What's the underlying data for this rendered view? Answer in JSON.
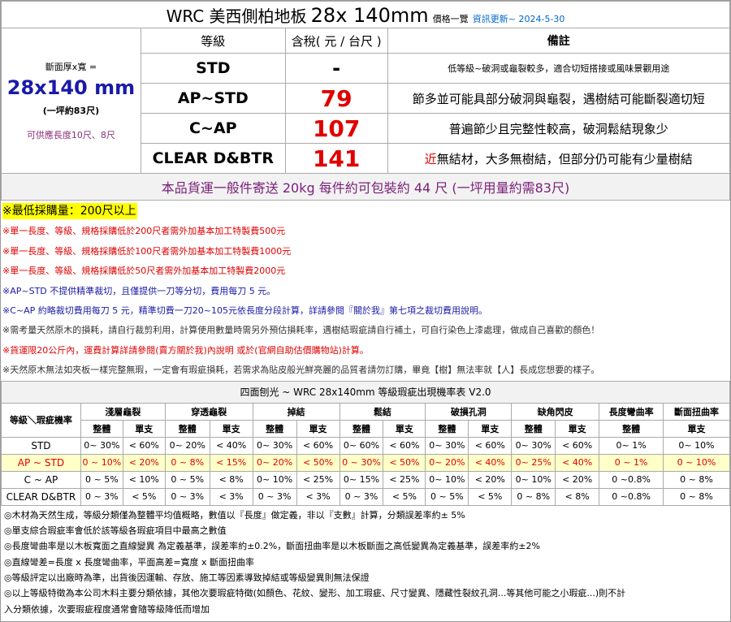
{
  "title": {
    "main": "WRC 美西側柏地板",
    "size": "28x 140mm",
    "subtitle": "價格一覽",
    "update": "資訊更新~ 2024-5-30"
  },
  "price_table": {
    "headers": {
      "grade": "等級",
      "price": "含稅( 元 / 台尺 )",
      "note": "備註"
    },
    "left": {
      "label": "斷面厚x寬 =",
      "size": "28x140 mm",
      "per_ping": "(一坪約83尺)",
      "length": "可供應長度10尺、8尺"
    },
    "rows": [
      {
        "grade": "STD",
        "price": "-",
        "note": "低等級~破洞或龜裂較多，適合切短搭接或風味景觀用途"
      },
      {
        "grade": "AP~STD",
        "price": "79",
        "note": "節多並可能具部分破洞與龜裂，遇樹結可能斷裂適切短"
      },
      {
        "grade": "C~AP",
        "price": "107",
        "note": "普遍節少且完整性較高，破洞鬆結現象少"
      },
      {
        "grade": "CLEAR  D&BTR",
        "price": "141",
        "note_red": "近",
        "note": "無結材，大多無樹結，但部分仍可能有少量樹結"
      }
    ],
    "shipping": "本品貨運一般件寄送 20kg 每件約可包裝約 44 尺 (一坪用量約需83尺)"
  },
  "notes": {
    "min_order": "※最低採購量：200尺以上",
    "lines": [
      "※單一長度、等級、規格採購低於200尺者需外加基本加工特製費500元",
      "※單一長度、等級、規格採購低於100尺者需外加基本加工特製費1000元",
      "※單一長度、等級、規格採購低於50尺者需外加基本加工特製費2000元",
      "※AP~STD 不提供精準裁切，且僅提供一刀等分切，費用每刀 5 元。",
      "※C~AP 約略裁切費用每刀 5 元，精準切費一刀20~105元依長度分段計算，詳請參閱『關於我』第七項之裁切費用說明。",
      "※需考量天然原木的損耗，請自行裁剪利用，計算使用數量時需另外預估損耗率，遇樹結瑕疵請自行補土，可自行染色上漆處理，做成自己喜歡的顏色！",
      "※貨運限20公斤內，運費計算詳請參閱(賣方關於我)內說明 或於(官網自助估價購物站)計算。",
      "※天然原木無法如夾板一樣完整無瑕，一定會有瑕疵損耗，若需求為貼皮般光鮮亮麗的品質者請勿訂購，畢竟【樹】無法率就【人】長成您想要的樣子。"
    ]
  },
  "defect_table": {
    "title": "四面刨光 ~ WRC 28x140mm 等級瑕疵出現機率表 V2.0",
    "corner": "等級＼瑕疵機率",
    "groups": [
      "淺層龜裂",
      "穿透龜裂",
      "掉結",
      "鬆結",
      "破損孔洞",
      "缺角閃皮",
      "長度彎曲率",
      "斷面扭曲率"
    ],
    "sub": {
      "whole": "整體",
      "single": "單支"
    },
    "rows": [
      {
        "grade": "STD",
        "cells": [
          "0~ 30%",
          "< 60%",
          "0~ 20%",
          "< 40%",
          "0~ 30%",
          "< 60%",
          "0~ 60%",
          "< 60%",
          "0~ 30%",
          "< 60%",
          "0~ 30%",
          "< 60%",
          "0~ 1%",
          "0~ 10%"
        ]
      },
      {
        "grade": "AP ~ STD",
        "cells": [
          "0 ~ 10%",
          "< 20%",
          "0 ~ 8%",
          "< 15%",
          "0~ 20%",
          "< 50%",
          "0 ~ 30%",
          "< 50%",
          "0~ 20%",
          "< 40%",
          "0~ 25%",
          "< 40%",
          "0 ~ 1%",
          "0 ~ 10%"
        ]
      },
      {
        "grade": "C ~ AP",
        "cells": [
          "0 ~ 5%",
          "< 10%",
          "0 ~ 5%",
          "< 8%",
          "0~ 10%",
          "< 25%",
          "0~ 15%",
          "< 25%",
          "0~ 10%",
          "< 20%",
          "0~ 10%",
          "< 20%",
          "0 ~0.8%",
          "0 ~ 8%"
        ]
      },
      {
        "grade": "CLEAR D&BTR",
        "cells": [
          "0 ~ 3%",
          "< 5%",
          "0 ~ 3%",
          "< 3%",
          "0 ~ 3%",
          "< 3%",
          "0 ~ 3%",
          "< 5%",
          "0 ~ 5%",
          "< 5%",
          "0 ~ 8%",
          "< 8%",
          "0 ~0.8%",
          "0 ~ 8%"
        ]
      }
    ]
  },
  "footnotes": [
    "◎木材為天然生成，等級分類僅為整體平均值概略，數值以『長度』做定義，非以『支數』計算，分類誤差率約± 5%",
    "◎單支綜合瑕疵率會低於該等級各瑕疵項目中最高之數值",
    "◎長度彎曲率是以木板寬面之直線變異 為定義基準，誤差率約±0.2%，斷面扭曲率是以木板斷面之高低變異為定義基準，誤差率約±2%",
    "◎直線彎差=長度 x 長度彎曲率，平面高差=寬度 x 斷面扭曲率",
    "◎等級評定以出廠時為準，出貨後因運輸、存放、施工等因素導致掉結或等級變異則無法保證",
    "◎以上等級特徵為本公司木料主要分類依據，其他次要瑕疵特徵(如顏色、花紋、變形、加工瑕疵、尺寸變異、隱藏性裂紋孔洞...等其他可能之小瑕疵...)則不計",
    "入分類依據，次要瑕疵程度通常會隨等級降低而增加"
  ],
  "colors": {
    "price": "#e00000",
    "size": "#1a1aa8",
    "highlight": "#ffff00",
    "ship": "#7a1e7a"
  }
}
